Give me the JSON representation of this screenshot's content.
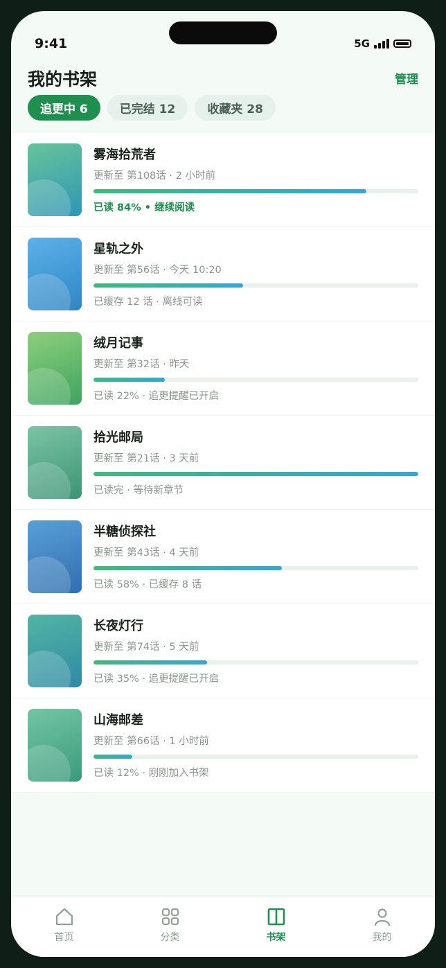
{
  "status_bar": {
    "time": "9:41",
    "network": "5G"
  },
  "header": {
    "title": "我的书架",
    "manage_label": "管理"
  },
  "tabs": [
    {
      "label": "追更中 6",
      "active": true
    },
    {
      "label": "已完结 12",
      "active": false
    },
    {
      "label": "收藏夹 28",
      "active": false
    }
  ],
  "books": [
    {
      "title": "雾海拾荒者",
      "update": "更新至 第108话 · 2 小时前",
      "progress": 0.84,
      "status": "已读 84% • 继续阅读",
      "highlight": true,
      "cover_colors": [
        "#66c49b",
        "#2f96b5"
      ]
    },
    {
      "title": "星轨之外",
      "update": "更新至 第56话 · 今天 10:20",
      "progress": 0.46,
      "status": "已缓存 12 话 · 离线可读",
      "highlight": false,
      "cover_colors": [
        "#5cb1e8",
        "#2f86c3"
      ]
    },
    {
      "title": "绒月记事",
      "update": "更新至 第32话 · 昨天",
      "progress": 0.22,
      "status": "已读 22% · 追更提醒已开启",
      "highlight": false,
      "cover_colors": [
        "#8ccf7c",
        "#3fa35f"
      ]
    },
    {
      "title": "拾光邮局",
      "update": "更新至 第21话 · 3 天前",
      "progress": 1.0,
      "status": "已读完 · 等待新章节",
      "highlight": false,
      "cover_colors": [
        "#7cc4a6",
        "#3b9473"
      ]
    },
    {
      "title": "半糖侦探社",
      "update": "更新至 第43话 · 4 天前",
      "progress": 0.58,
      "status": "已读 58% · 已缓存 8 话",
      "highlight": false,
      "cover_colors": [
        "#5a9fd8",
        "#2f6fad"
      ]
    },
    {
      "title": "长夜灯行",
      "update": "更新至 第74话 · 5 天前",
      "progress": 0.35,
      "status": "已读 35% · 追更提醒已开启",
      "highlight": false,
      "cover_colors": [
        "#52b5a3",
        "#2f8aa6"
      ]
    },
    {
      "title": "山海邮差",
      "update": "更新至 第66话 · 1 小时前",
      "progress": 0.12,
      "status": "已读 12% · 刚刚加入书架",
      "highlight": false,
      "cover_colors": [
        "#72c6a4",
        "#3a9a7c"
      ]
    }
  ],
  "nav": [
    {
      "label": "首页",
      "icon": "home-icon",
      "active": false
    },
    {
      "label": "分类",
      "icon": "grid-icon",
      "active": false
    },
    {
      "label": "书架",
      "icon": "bookshelf-icon",
      "active": true
    },
    {
      "label": "我的",
      "icon": "profile-icon",
      "active": false
    }
  ],
  "colors": {
    "accent": "#1f8f50",
    "background": "#f4fbf7"
  }
}
